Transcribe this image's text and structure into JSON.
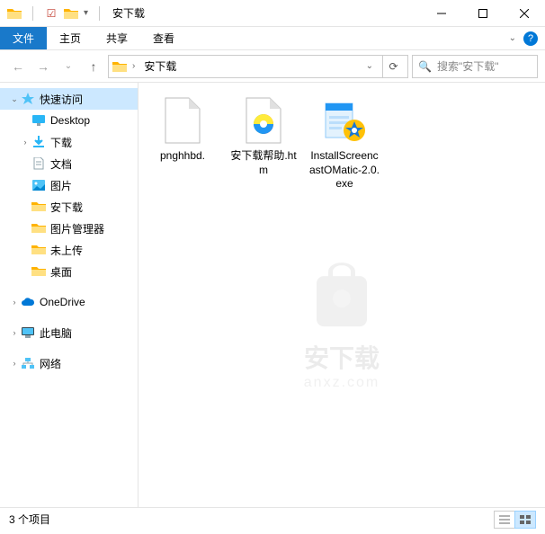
{
  "window": {
    "title": "安下载"
  },
  "ribbon": {
    "file": "文件",
    "home": "主页",
    "share": "共享",
    "view": "查看"
  },
  "address": {
    "crumb": "安下载"
  },
  "search": {
    "placeholder": "搜索\"安下载\""
  },
  "sidebar": {
    "quick": "快速访问",
    "items": [
      {
        "label": "Desktop"
      },
      {
        "label": "下载"
      },
      {
        "label": "文档"
      },
      {
        "label": "图片"
      },
      {
        "label": "安下载"
      },
      {
        "label": "图片管理器"
      },
      {
        "label": "未上传"
      },
      {
        "label": "桌面"
      }
    ],
    "onedrive": "OneDrive",
    "thispc": "此电脑",
    "network": "网络"
  },
  "files": [
    {
      "label": "pnghhbd."
    },
    {
      "label": "安下载帮助.htm"
    },
    {
      "label": "InstallScreencastOMatic-2.0.exe"
    }
  ],
  "watermark": {
    "text": "安下载",
    "sub": "anxz.com"
  },
  "status": {
    "count": "3 个项目"
  }
}
